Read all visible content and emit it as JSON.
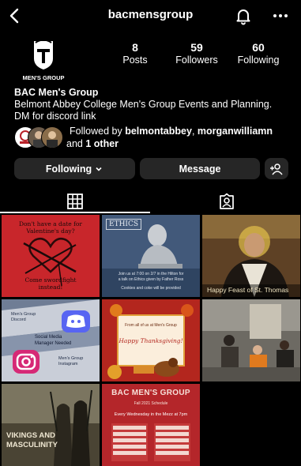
{
  "header": {
    "username": "bacmensgroup",
    "back_icon": "chevron-left-icon",
    "bell_icon": "bell-icon",
    "more_icon": "more-dots-icon"
  },
  "profile": {
    "logo_text": "MEN'S GROUP",
    "posts_count": "8",
    "posts_label": "Posts",
    "followers_count": "59",
    "followers_label": "Followers",
    "following_count": "60",
    "following_label": "Following",
    "name": "BAC Men's Group",
    "bio_line1": "Belmont Abbey College Men's Group Events and Planning.",
    "bio_line2": "DM for discord link",
    "followed_prefix": "Followed by ",
    "followed_user1": "belmontabbey",
    "followed_sep": ", ",
    "followed_user2": "morganwilliamn",
    "followed_and": " and ",
    "followed_other": "1 other"
  },
  "buttons": {
    "following": "Following",
    "message": "Message"
  },
  "posts": [
    {
      "l1": "Don't have a date for",
      "l2": "Valentine's day?",
      "l3": "Come swordfight",
      "l4": "instead!"
    },
    {
      "title": "ETHICS",
      "l1": "Join us at 7:00 on 2/7 in the Hilton for",
      "l2": "a talk on Ethics given by Father Ross",
      "l3": "Cookies and coke will be provided"
    },
    {
      "caption": "Happy Feast of St. Thomas"
    },
    {
      "l1": "Men's Group",
      "l2": "Discord",
      "l3": "Social Media",
      "l4": "Manager Needed",
      "l5": "Men's Group",
      "l6": "Instagram"
    },
    {
      "l1": "From all of us at Men's Group",
      "l2": "Happy Thanksgiving!"
    },
    {},
    {
      "l1": "VIKINGS AND",
      "l2": "MASCULINITY"
    },
    {
      "title": "BAC MEN'S GROUP",
      "sub": "Fall 2021 Schedule",
      "l1": "Every Wednesday in the Mezz at 7pm"
    }
  ],
  "colors": {
    "background": "#000000",
    "button": "#262626",
    "valentine_red": "#c8262b",
    "ethics_blue": "#2f4461",
    "thanksgiving_red": "#b3261e"
  }
}
